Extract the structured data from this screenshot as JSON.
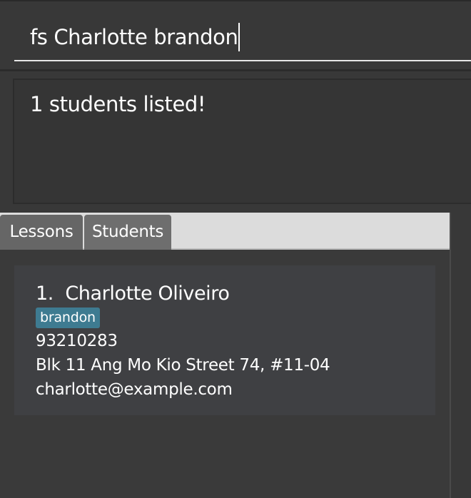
{
  "command_box": {
    "value": "fs Charlotte brandon"
  },
  "result_display": {
    "message": "1 students listed!"
  },
  "tabs": [
    {
      "label": "Lessons"
    },
    {
      "label": "Students"
    }
  ],
  "students": [
    {
      "index": "1.",
      "name": "Charlotte Oliveiro",
      "tags": [
        "brandon"
      ],
      "phone": "93210283",
      "address": "Blk 11 Ang Mo Kio Street 74, #11-04",
      "email": "charlotte@example.com"
    }
  ],
  "colors": {
    "background": "#383838",
    "tab_header": "#dcdcdc",
    "tab": "#666666",
    "card": "#3f4043",
    "tag": "#3e7b91"
  }
}
